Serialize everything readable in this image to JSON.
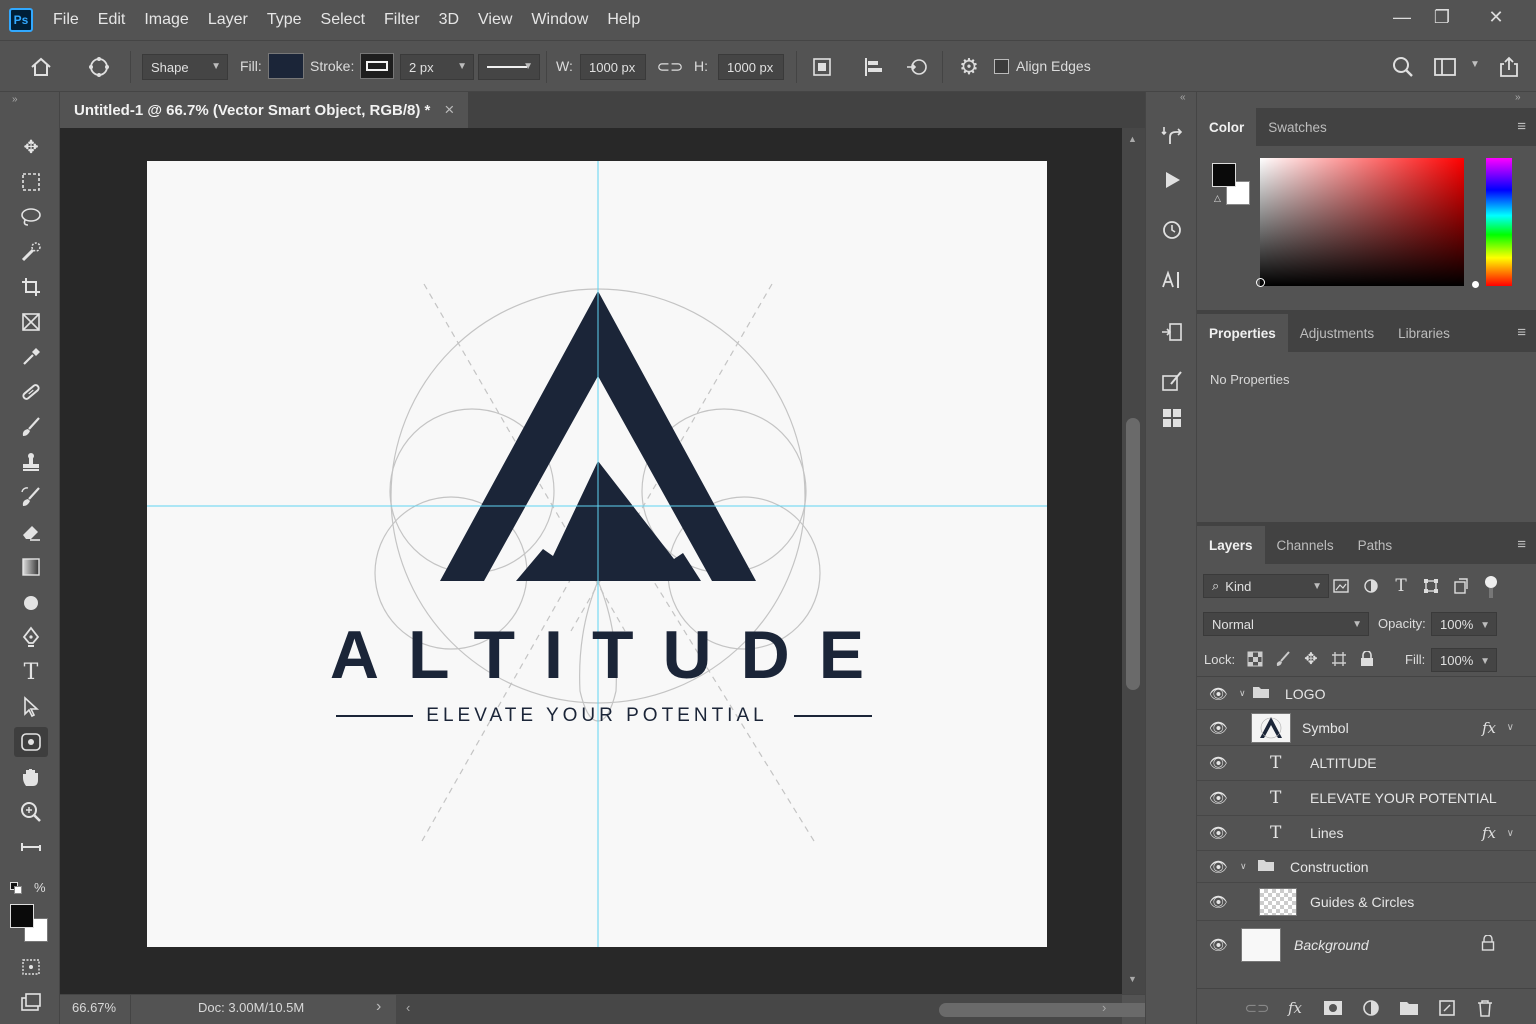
{
  "app": {
    "logo_text": "Ps"
  },
  "menu": [
    "File",
    "Edit",
    "Image",
    "Layer",
    "Type",
    "Select",
    "Filter",
    "3D",
    "View",
    "Window",
    "Help"
  ],
  "window_controls": {
    "minimize": "—",
    "restore": "❐",
    "close": "✕"
  },
  "options": {
    "mode": "Shape",
    "fill_label": "Fill:",
    "stroke_label": "Stroke:",
    "stroke_width": "2 px",
    "w_label": "W:",
    "w_value": "1000 px",
    "h_label": "H:",
    "h_value": "1000 px",
    "align_edges_label": "Align Edges",
    "fill_color": "#1b2538"
  },
  "document": {
    "tab_title": "Untitled-1 @ 66.7% (Vector Smart Object, RGB/8) *",
    "close": "×",
    "zoom": "66.67%",
    "doc_info": "Doc: 3.00M/10.5M"
  },
  "artwork": {
    "wordmark": "ALTITUDE",
    "tagline": "ELEVATE YOUR POTENTIAL",
    "ink_color": "#1b2538",
    "guide_color": "#5fd4f2"
  },
  "color_panel": {
    "tabs": [
      "Color",
      "Swatches"
    ],
    "foreground": "#0a0a0a",
    "background": "#ffffff"
  },
  "properties_panel": {
    "tabs": [
      "Properties",
      "Adjustments",
      "Libraries"
    ],
    "message": "No Properties"
  },
  "layers_panel": {
    "tabs": [
      "Layers",
      "Channels",
      "Paths"
    ],
    "filter_label": "Kind",
    "blend_mode": "Normal",
    "opacity_label": "Opacity:",
    "opacity_value": "100%",
    "lock_label": "Lock:",
    "fill_label": "Fill:",
    "fill_value": "100%",
    "layers": [
      {
        "name": "LOGO",
        "kind": "group"
      },
      {
        "name": "Symbol",
        "kind": "smart",
        "fx": "fx"
      },
      {
        "name": "ALTITUDE",
        "kind": "text",
        "type_glyph": "T"
      },
      {
        "name": "ELEVATE YOUR POTENTIAL",
        "kind": "text",
        "type_glyph": "T"
      },
      {
        "name": "Lines",
        "kind": "text",
        "type_glyph": "T",
        "fx": "fx"
      },
      {
        "name": "Construction",
        "kind": "group"
      },
      {
        "name": "Guides & Circles",
        "kind": "raster"
      },
      {
        "name": "Background",
        "kind": "background"
      }
    ]
  }
}
